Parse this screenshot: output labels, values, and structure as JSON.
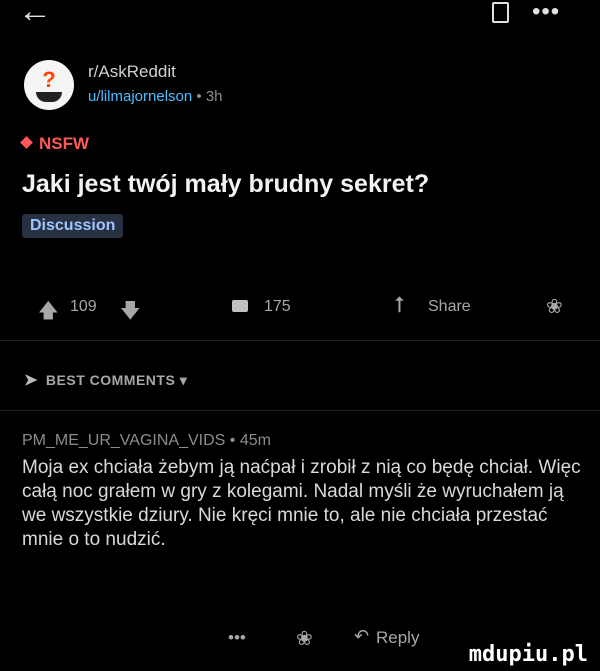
{
  "topbar": {
    "back_icon": "arrow-left-icon",
    "bookmark_icon": "bookmark-icon",
    "more_icon": "more-horizontal-icon",
    "more_label": "•••"
  },
  "post": {
    "subreddit": "r/AskReddit",
    "author": "u/lilmajornelson",
    "time": "3h",
    "nsfw": "NSFW",
    "title": "Jaki jest twój mały brudny sekret?",
    "flair": "Discussion",
    "upvotes": "109",
    "comments": "175",
    "share": "Share"
  },
  "sort": {
    "label": "BEST COMMENTS"
  },
  "comment": {
    "author": "PM_ME_UR_VAGINA_VIDS",
    "time": "45m",
    "body": "Moja ex chciała żebym ją naćpał i zrobił z nią co będę chciał. Więc całą noc grałem w gry z kolegami. Nadal myśli że wyruchałem ją we wszystkie dziury. Nie kręci mnie to, ale nie chciała przestać mnie o to nudzić.",
    "more": "•••",
    "reply": "Reply"
  },
  "watermark": "mdupiu.pl",
  "colors": {
    "background": "#000000",
    "nsfw": "#ff585b",
    "username": "#4fbcff",
    "flair_bg": "#273142"
  }
}
